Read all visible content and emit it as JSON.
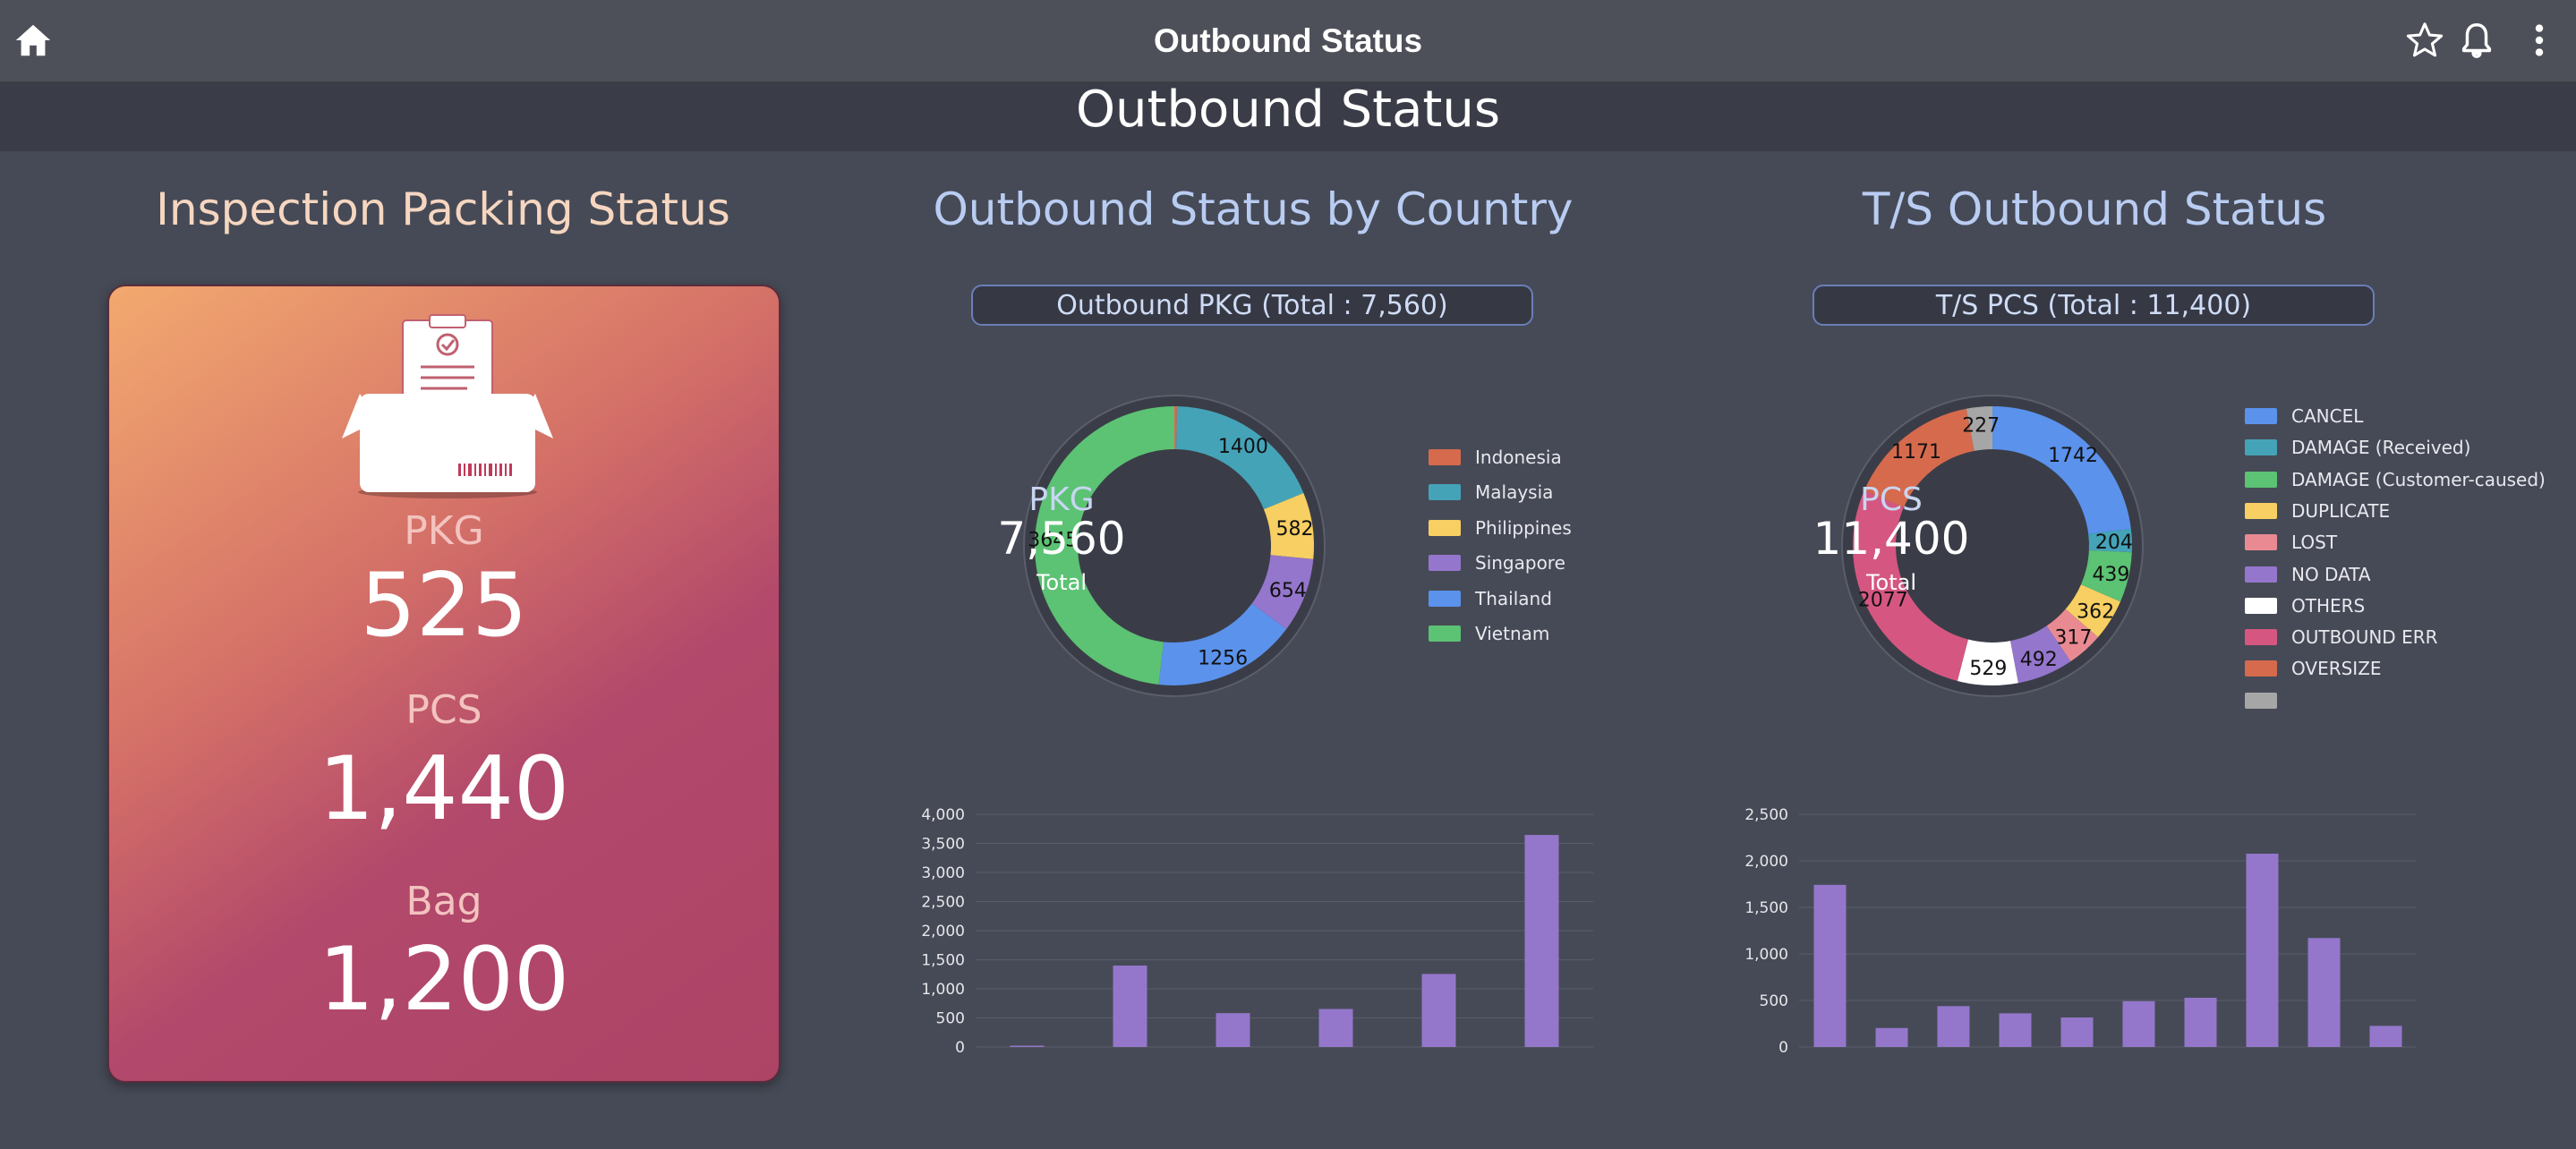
{
  "appbar": {
    "title": "Outbound Status",
    "icons": [
      "home-icon",
      "star-icon",
      "bell-icon",
      "more-vertical-icon"
    ]
  },
  "banner": {
    "title": "Outbound Status"
  },
  "inspection": {
    "title": "Inspection Packing Status",
    "pkg_label": "PKG",
    "pkg_value": "525",
    "pcs_label": "PCS",
    "pcs_value": "1,440",
    "bag_label": "Bag",
    "bag_value": "1,200",
    "icon": "package-box-icon"
  },
  "country": {
    "title": "Outbound Status by Country",
    "pill": "Outbound PKG (Total : 7,560)",
    "center_label": "PKG",
    "center_value": "7,560",
    "center_sub": "Total"
  },
  "ts": {
    "title": "T/S Outbound Status",
    "pill": "T/S PCS (Total : 11,400)",
    "center_label": "PCS",
    "center_value": "11,400",
    "center_sub": "Total"
  },
  "colors": {
    "background": "#464a56",
    "appbar": "#4e5059",
    "banner": "#3a3d47",
    "title_peach": "#f6d6c0",
    "title_blue": "#b9ccf2",
    "bar": "#9477cb"
  },
  "chart_data": [
    {
      "type": "pie",
      "donut": true,
      "categories": [
        "Indonesia",
        "Malaysia",
        "Philippines",
        "Singapore",
        "Thailand",
        "Vietnam"
      ],
      "values": [
        23,
        1400,
        582,
        654,
        1256,
        3645
      ],
      "colors": [
        "#d66a4d",
        "#45a3b8",
        "#f7cf62",
        "#9476cc",
        "#5b92ec",
        "#5cc274"
      ],
      "legend": "right"
    },
    {
      "type": "pie",
      "donut": true,
      "categories": [
        "CANCEL",
        "DAMAGE (Received)",
        "DAMAGE (Customer-caused)",
        "DUPLICATE",
        "LOST",
        "NO DATA",
        "OTHERS",
        "OUTBOUND ERR",
        "OVERSIZE",
        ""
      ],
      "values": [
        1742,
        204,
        439,
        362,
        317,
        492,
        529,
        2077,
        1171,
        227
      ],
      "colors": [
        "#5b92ec",
        "#45a3b8",
        "#5cc274",
        "#f7cf62",
        "#e98a93",
        "#9476cc",
        "#ffffff",
        "#d55781",
        "#d66a4d",
        "#a6a6a6"
      ],
      "legend": "right"
    },
    {
      "type": "bar",
      "categories": [
        "Indonesia",
        "Malaysia",
        "Philippines",
        "Singapore",
        "Thailand",
        "Vietnam"
      ],
      "values": [
        23,
        1400,
        582,
        654,
        1256,
        3645
      ],
      "ylim": [
        0,
        4000
      ],
      "yticks": [
        "0",
        "500",
        "1,000",
        "1,500",
        "2,000",
        "2,500",
        "3,000",
        "3,500",
        "4,000"
      ],
      "grid": true
    },
    {
      "type": "bar",
      "categories": [
        "CANCEL",
        "DAMAGE (Received)",
        "DAMAGE (Customer-caused)",
        "DUPLICATE",
        "LOST",
        "NO DATA",
        "OTHERS",
        "OUTBOUND ERR",
        "OVERSIZE",
        ""
      ],
      "values": [
        1742,
        204,
        439,
        362,
        317,
        492,
        529,
        2077,
        1171,
        227
      ],
      "ylim": [
        0,
        2500
      ],
      "yticks": [
        "0",
        "500",
        "1,000",
        "1,500",
        "2,000",
        "2,500"
      ],
      "grid": true
    }
  ]
}
